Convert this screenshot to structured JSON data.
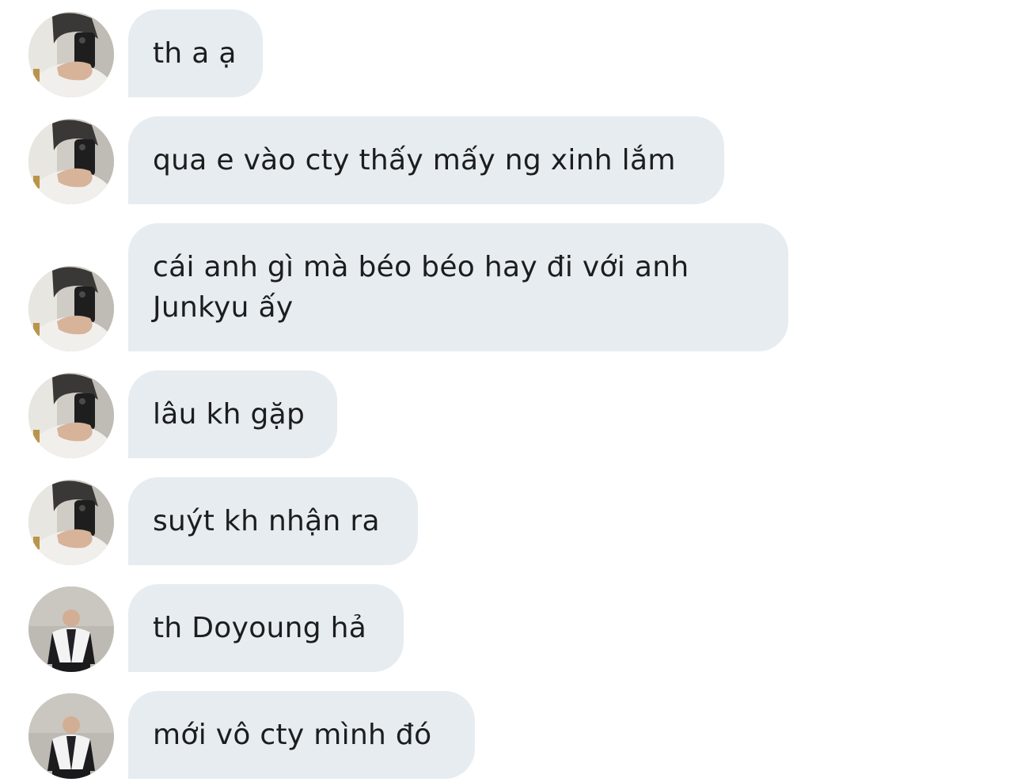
{
  "conversation": {
    "messages": [
      {
        "sender_avatar": "mirror-selfie",
        "text": "th a ạ"
      },
      {
        "sender_avatar": "mirror-selfie",
        "text": "qua e vào cty thấy mấy ng xinh lắm"
      },
      {
        "sender_avatar": "mirror-selfie",
        "text": "cái anh gì mà béo béo hay đi với anh\nJunkyu ấy"
      },
      {
        "sender_avatar": "mirror-selfie",
        "text": "lâu kh gặp"
      },
      {
        "sender_avatar": "mirror-selfie",
        "text": "suýt kh nhận ra"
      },
      {
        "sender_avatar": "jacket-portrait",
        "text": "th Doyoung hả"
      },
      {
        "sender_avatar": "jacket-portrait",
        "text": "mới vô cty mình đó"
      }
    ]
  },
  "colors": {
    "bubble_background": "#e6ecf0",
    "text": "#1c1d1f",
    "page_background": "#ffffff"
  }
}
